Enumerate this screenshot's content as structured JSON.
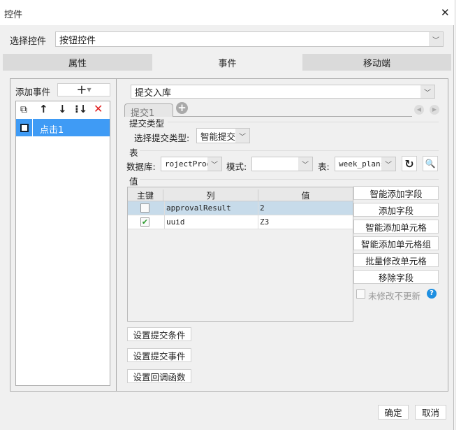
{
  "window": {
    "title": "控件",
    "close": "✕"
  },
  "select_control": {
    "label": "选择控件",
    "value": "按钮控件"
  },
  "tabs": [
    {
      "label": "属性"
    },
    {
      "label": "事件"
    },
    {
      "label": "移动端"
    }
  ],
  "left": {
    "add_event_label": "添加事件",
    "add_button": "+",
    "items": [
      {
        "label": "点击1"
      }
    ]
  },
  "right": {
    "action": "提交入库",
    "sub_tab": "提交1",
    "submit_type_section": "提交类型",
    "submit_type_label": "选择提交类型:",
    "submit_type_value": "智能提交",
    "table_section": "表",
    "db_label": "数据库:",
    "db_value": "rojectProd",
    "schema_label": "模式:",
    "schema_value": "",
    "table_label": "表:",
    "table_value": "week_plans",
    "value_section": "值",
    "columns": [
      "主键",
      "列",
      "值"
    ],
    "rows": [
      {
        "key": false,
        "col": "approvalResult",
        "val": "2"
      },
      {
        "key": true,
        "col": "uuid",
        "val": "Z3"
      }
    ],
    "side_buttons": [
      "智能添加字段",
      "添加字段",
      "智能添加单元格",
      "智能添加单元格组",
      "批量修改单元格",
      "移除字段"
    ],
    "no_update_label": "未修改不更新",
    "bottom_buttons": [
      "设置提交条件",
      "设置提交事件",
      "设置回调函数"
    ]
  },
  "footer": {
    "ok": "确定",
    "cancel": "取消"
  }
}
